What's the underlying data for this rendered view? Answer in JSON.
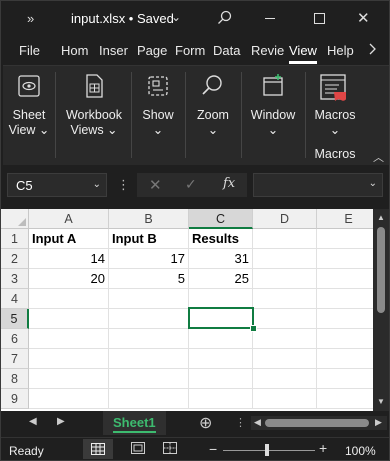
{
  "titlebar": {
    "more": "»",
    "title": "input.xlsx • Saved",
    "title_chevron": "⌄",
    "search_icon": "search-icon",
    "close": "✕"
  },
  "tabs": [
    "File",
    "Hom",
    "Inser",
    "Page",
    "Form",
    "Data",
    "Revie",
    "View",
    "Help"
  ],
  "active_tab": "View",
  "ribbon": {
    "groups": [
      {
        "icon": "sheet-view-icon",
        "line1": "Sheet",
        "line2": "View ⌄"
      },
      {
        "icon": "workbook-views-icon",
        "line1": "Workbook",
        "line2": "Views ⌄"
      },
      {
        "icon": "show-icon",
        "line1": "Show",
        "line2": "⌄"
      },
      {
        "icon": "zoom-icon",
        "line1": "Zoom",
        "line2": "⌄"
      },
      {
        "icon": "window-icon",
        "line1": "Window",
        "line2": "⌄"
      },
      {
        "icon": "macros-icon",
        "line1": "Macros",
        "line2": "⌄"
      }
    ],
    "macros_group_label": "Macros",
    "collapse": "︿"
  },
  "formula_bar": {
    "name_box": "C5",
    "dropdown": "⌄",
    "dots": "⋮",
    "cancel": "✕",
    "enter": "✓",
    "fx": "fx",
    "formula": "",
    "expand": "⌄"
  },
  "sheet": {
    "columns": [
      "A",
      "B",
      "C",
      "D",
      "E"
    ],
    "rows": [
      "1",
      "2",
      "3",
      "4",
      "5",
      "6",
      "7",
      "8",
      "9"
    ],
    "cells": {
      "A1": "Input A",
      "B1": "Input B",
      "C1": "Results",
      "A2": "14",
      "B2": "17",
      "C2": "31",
      "A3": "20",
      "B3": "5",
      "C3": "25"
    },
    "selected_cell": "C5"
  },
  "sheet_bar": {
    "prev": "◀",
    "next": "▶",
    "active_sheet": "Sheet1",
    "add": "⊕",
    "dots": "⋮"
  },
  "status_bar": {
    "ready": "Ready",
    "zoom_minus": "−",
    "zoom_plus": "+",
    "zoom_level": "100%"
  }
}
